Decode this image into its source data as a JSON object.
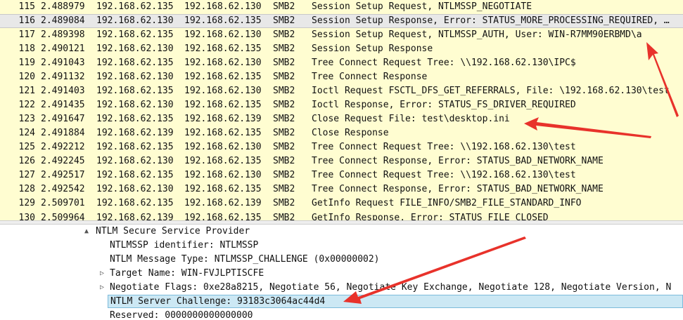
{
  "packets": [
    {
      "no": "115",
      "time": "2.488979",
      "src": "192.168.62.135",
      "dst": "192.168.62.130",
      "proto": "SMB2",
      "info": "Session Setup Request, NTLMSSP_NEGOTIATE"
    },
    {
      "no": "116",
      "time": "2.489084",
      "src": "192.168.62.130",
      "dst": "192.168.62.135",
      "proto": "SMB2",
      "info": "Session Setup Response, Error: STATUS_MORE_PROCESSING_REQUIRED, …"
    },
    {
      "no": "117",
      "time": "2.489398",
      "src": "192.168.62.135",
      "dst": "192.168.62.130",
      "proto": "SMB2",
      "info": "Session Setup Request, NTLMSSP_AUTH, User: WIN-R7MM90ERBMD\\a"
    },
    {
      "no": "118",
      "time": "2.490121",
      "src": "192.168.62.130",
      "dst": "192.168.62.135",
      "proto": "SMB2",
      "info": "Session Setup Response"
    },
    {
      "no": "119",
      "time": "2.491043",
      "src": "192.168.62.135",
      "dst": "192.168.62.130",
      "proto": "SMB2",
      "info": "Tree Connect Request Tree: \\\\192.168.62.130\\IPC$"
    },
    {
      "no": "120",
      "time": "2.491132",
      "src": "192.168.62.130",
      "dst": "192.168.62.135",
      "proto": "SMB2",
      "info": "Tree Connect Response"
    },
    {
      "no": "121",
      "time": "2.491403",
      "src": "192.168.62.135",
      "dst": "192.168.62.130",
      "proto": "SMB2",
      "info": "Ioctl Request FSCTL_DFS_GET_REFERRALS, File: \\192.168.62.130\\test"
    },
    {
      "no": "122",
      "time": "2.491435",
      "src": "192.168.62.130",
      "dst": "192.168.62.135",
      "proto": "SMB2",
      "info": "Ioctl Response, Error: STATUS_FS_DRIVER_REQUIRED"
    },
    {
      "no": "123",
      "time": "2.491647",
      "src": "192.168.62.135",
      "dst": "192.168.62.139",
      "proto": "SMB2",
      "info": "Close Request File: test\\desktop.ini"
    },
    {
      "no": "124",
      "time": "2.491884",
      "src": "192.168.62.139",
      "dst": "192.168.62.135",
      "proto": "SMB2",
      "info": "Close Response"
    },
    {
      "no": "125",
      "time": "2.492212",
      "src": "192.168.62.135",
      "dst": "192.168.62.130",
      "proto": "SMB2",
      "info": "Tree Connect Request Tree: \\\\192.168.62.130\\test"
    },
    {
      "no": "126",
      "time": "2.492245",
      "src": "192.168.62.130",
      "dst": "192.168.62.135",
      "proto": "SMB2",
      "info": "Tree Connect Response, Error: STATUS_BAD_NETWORK_NAME"
    },
    {
      "no": "127",
      "time": "2.492517",
      "src": "192.168.62.135",
      "dst": "192.168.62.130",
      "proto": "SMB2",
      "info": "Tree Connect Request Tree: \\\\192.168.62.130\\test"
    },
    {
      "no": "128",
      "time": "2.492542",
      "src": "192.168.62.130",
      "dst": "192.168.62.135",
      "proto": "SMB2",
      "info": "Tree Connect Response, Error: STATUS_BAD_NETWORK_NAME"
    },
    {
      "no": "129",
      "time": "2.509701",
      "src": "192.168.62.135",
      "dst": "192.168.62.139",
      "proto": "SMB2",
      "info": "GetInfo Request FILE_INFO/SMB2_FILE_STANDARD_INFO"
    },
    {
      "no": "130",
      "time": "2.509964",
      "src": "192.168.62.139",
      "dst": "192.168.62.135",
      "proto": "SMB2",
      "info": "GetInfo Response, Error: STATUS_FILE_CLOSED"
    }
  ],
  "details": {
    "section": "NTLM Secure Service Provider",
    "identifier": "NTLMSSP identifier: NTLMSSP",
    "message_type": "NTLM Message Type: NTLMSSP_CHALLENGE (0x00000002)",
    "target_name": "Target Name: WIN-FVJLPTISCFE",
    "negotiate_flags": "Negotiate Flags: 0xe28a8215, Negotiate 56, Negotiate Key Exchange, Negotiate 128, Negotiate Version, N",
    "server_challenge": "NTLM Server Challenge: 93183c3064ac44d4",
    "reserved": "Reserved: 0000000000000000"
  },
  "icons": {
    "expanded": "▲",
    "collapsed": "▷"
  },
  "colors": {
    "row_bg": "#fffdd1",
    "selected_row": "#e8e8e8",
    "selected_detail": "#cce8f4",
    "arrow": "#e8322b"
  }
}
